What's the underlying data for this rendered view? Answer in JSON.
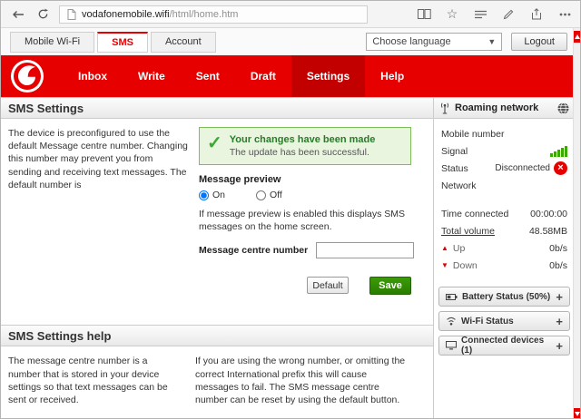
{
  "browser": {
    "url_host": "vodafonemobile.wifi",
    "url_path": "/html/home.htm"
  },
  "header": {
    "tabs": [
      {
        "label": "Mobile Wi-Fi"
      },
      {
        "label": "SMS"
      },
      {
        "label": "Account"
      }
    ],
    "language_dropdown": "Choose language",
    "logout": "Logout"
  },
  "nav": {
    "items": [
      {
        "label": "Inbox"
      },
      {
        "label": "Write"
      },
      {
        "label": "Sent"
      },
      {
        "label": "Draft"
      },
      {
        "label": "Settings"
      },
      {
        "label": "Help"
      }
    ]
  },
  "settings": {
    "title": "SMS Settings",
    "intro": "The device is preconfigured to use the default Message centre number. Changing this number may prevent you from sending and receiving text messages. The default number is",
    "success": {
      "title": "Your changes have been made",
      "text": "The update has been successful."
    },
    "preview": {
      "label": "Message preview",
      "on": "On",
      "off": "Off",
      "help": "If message preview is enabled this displays SMS messages on the home screen."
    },
    "centre_number_label": "Message centre number",
    "buttons": {
      "default": "Default",
      "save": "Save"
    }
  },
  "help": {
    "title": "SMS Settings help",
    "col1": "The message centre number is a number that is stored in your device settings so that text messages can be sent or received.",
    "col2": "If you are using the wrong number, or omitting the correct International prefix this will cause messages to fail. The SMS message centre number can be reset by using the default button."
  },
  "sidebar": {
    "title": "Roaming network",
    "mobile_number_label": "Mobile number",
    "signal_label": "Signal",
    "status_label": "Status",
    "status_value": "Disconnected",
    "network_label": "Network",
    "time_label": "Time connected",
    "time_value": "00:00:00",
    "volume_label": "Total volume",
    "volume_value": "48.58MB",
    "up_label": "Up",
    "up_value": "0b/s",
    "down_label": "Down",
    "down_value": "0b/s",
    "accordions": [
      {
        "label": "Battery Status (50%)"
      },
      {
        "label": "Wi-Fi Status"
      },
      {
        "label": "Connected devices (1)"
      }
    ]
  },
  "colors": {
    "vodafone_red": "#e60000",
    "nav_active_red": "#c20000",
    "save_green": "#2b7d00",
    "success_border": "#7cbf5a",
    "success_bg": "#e9f5de",
    "signal_green": "#3aaa00",
    "status_red": "#e60000"
  }
}
